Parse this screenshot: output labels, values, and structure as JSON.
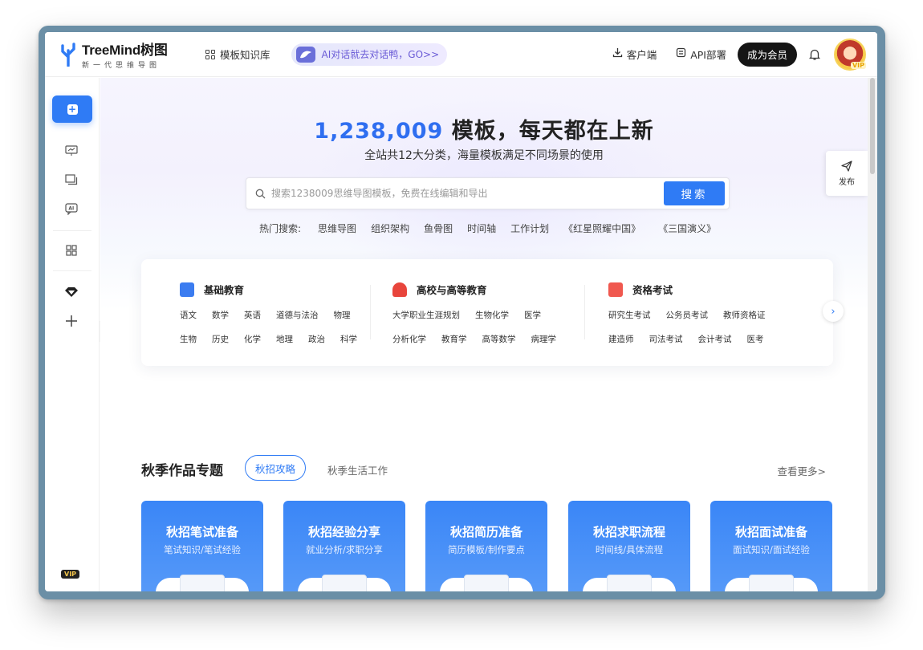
{
  "header": {
    "brand": "TreeMind树图",
    "tagline": "新一代思维导图",
    "template_library": "模板知识库",
    "ai_pill": "AI对话就去对话鸭，GO>>",
    "client": "客户端",
    "api": "API部署",
    "vip_button": "成为会员",
    "avatar_badge": "VIP"
  },
  "sidebar": {
    "vip_badge": "VIP"
  },
  "hero": {
    "count": "1,238,009",
    "title_rest": " 模板，每天都在上新",
    "subtitle": "全站共12大分类，海量模板满足不同场景的使用",
    "search_placeholder": "搜索1238009思维导图模板，免费在线编辑和导出",
    "search_button": "搜索",
    "hot_label": "热门搜索:",
    "hot_keywords": [
      "思维导图",
      "组织架构",
      "鱼骨图",
      "时间轴",
      "工作计划",
      "《红星照耀中国》",
      "《三国演义》"
    ]
  },
  "categories": [
    {
      "title": "基础教育",
      "color": "#3b7cf0",
      "rows": [
        [
          "语文",
          "数学",
          "英语",
          "道德与法治",
          "物理"
        ],
        [
          "生物",
          "历史",
          "化学",
          "地理",
          "政治",
          "科学"
        ]
      ]
    },
    {
      "title": "高校与高等教育",
      "color": "#e8453c",
      "rows": [
        [
          "大学职业生涯规划",
          "生物化学",
          "医学"
        ],
        [
          "分析化学",
          "教育学",
          "高等数学",
          "病理学"
        ]
      ]
    },
    {
      "title": "资格考试",
      "color": "#f0584f",
      "rows": [
        [
          "研究生考试",
          "公务员考试",
          "教师资格证"
        ],
        [
          "建造师",
          "司法考试",
          "会计考试",
          "医考"
        ]
      ]
    }
  ],
  "publish": "发布",
  "section": {
    "title": "秋季作品专题",
    "tab_active": "秋招攻略",
    "tab_other": "秋季生活工作",
    "see_more": "查看更多>",
    "cards": [
      {
        "title": "秋招笔试准备",
        "sub": "笔试知识/笔试经验"
      },
      {
        "title": "秋招经验分享",
        "sub": "就业分析/求职分享"
      },
      {
        "title": "秋招简历准备",
        "sub": "简历模板/制作要点"
      },
      {
        "title": "秋招求职流程",
        "sub": "时间线/具体流程"
      },
      {
        "title": "秋招面试准备",
        "sub": "面试知识/面试经验"
      }
    ]
  }
}
